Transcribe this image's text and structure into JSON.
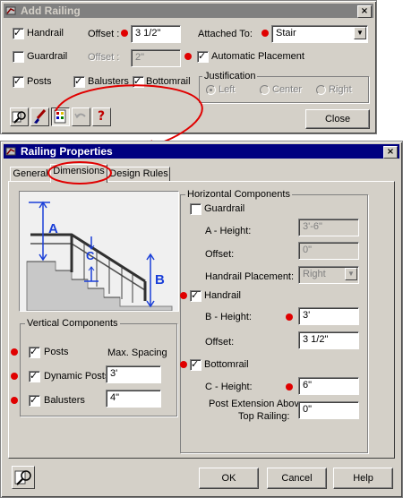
{
  "add_railing": {
    "title": "Add Railing",
    "close_x": "×",
    "handrail": {
      "label": "Handrail",
      "checked": true
    },
    "handrail_offset_label": "Offset :",
    "handrail_offset_value": "3 1/2\"",
    "attached_to_label": "Attached To:",
    "attached_to_value": "Stair",
    "guardrail": {
      "label": "Guardrail",
      "checked": false
    },
    "guardrail_offset_label": "Offset :",
    "guardrail_offset_value": "2\"",
    "automatic_placement": {
      "label": "Automatic Placement",
      "checked": true
    },
    "posts": {
      "label": "Posts",
      "checked": true
    },
    "balusters": {
      "label": "Balusters",
      "checked": true
    },
    "bottomrail": {
      "label": "Bottomrail",
      "checked": true
    },
    "justification": {
      "title": "Justification",
      "options": [
        "Left",
        "Center",
        "Right"
      ]
    },
    "tools": [
      "match-icon",
      "paintbrush-icon",
      "properties-icon",
      "undo-icon",
      "help-icon"
    ],
    "help_glyph": "?",
    "close_button": "Close"
  },
  "railing_properties": {
    "title": "Railing Properties",
    "close_x": "×",
    "tabs": [
      "General",
      "Dimensions",
      "Design Rules"
    ],
    "active_tab": "Dimensions",
    "diagram_labels": {
      "a": "A",
      "b": "B",
      "c": "C"
    },
    "vertical_components": {
      "title": "Vertical Components",
      "max_spacing_label": "Max. Spacing",
      "posts": {
        "label": "Posts",
        "checked": true
      },
      "dynamic_posts": {
        "label": "Dynamic Posts",
        "checked": true,
        "value": "3'"
      },
      "balusters": {
        "label": "Balusters",
        "checked": true,
        "value": "4\""
      }
    },
    "horizontal_components": {
      "title": "Horizontal Components",
      "guardrail": {
        "label": "Guardrail",
        "checked": false
      },
      "a_height_label": "A - Height:",
      "a_height_value": "3'-6\"",
      "guard_offset_label": "Offset:",
      "guard_offset_value": "0\"",
      "handrail_placement_label": "Handrail Placement:",
      "handrail_placement_value": "Right",
      "handrail": {
        "label": "Handrail",
        "checked": true
      },
      "b_height_label": "B - Height:",
      "b_height_value": "3'",
      "handrail_offset_label": "Offset:",
      "handrail_offset_value": "3 1/2\"",
      "bottomrail": {
        "label": "Bottomrail",
        "checked": true
      },
      "c_height_label": "C - Height:",
      "c_height_value": "6\"",
      "post_extension_label_1": "Post Extension Above",
      "post_extension_label_2": "Top Railing:",
      "post_extension_value": "0\""
    },
    "ok_button": "OK",
    "cancel_button": "Cancel",
    "help_button": "Help"
  },
  "colors": {
    "annotation_red": "#e00000",
    "dialog_gray": "#d4d0c8",
    "title_active": "#000080",
    "diagram_blue": "#1a3fd8"
  }
}
